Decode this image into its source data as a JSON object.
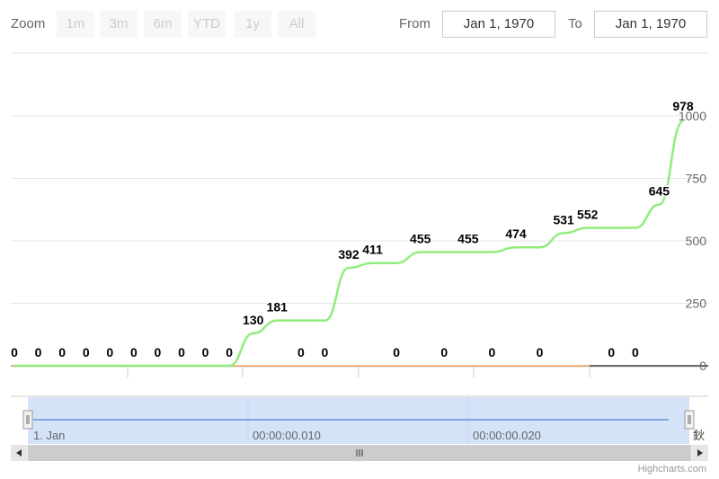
{
  "range_selector": {
    "zoom_label": "Zoom",
    "buttons": [
      "1m",
      "3m",
      "6m",
      "YTD",
      "1y",
      "All"
    ],
    "from_label": "From",
    "from_value": "Jan 1, 1970",
    "to_label": "To",
    "to_value": "Jan 1, 1970"
  },
  "navigator": {
    "labels": [
      "1. Jan",
      "00:00:00.010",
      "00:00:00.020"
    ],
    "right_glyph": "鈥"
  },
  "credit": "Highcharts.com",
  "colors": {
    "series": "#90ed7d",
    "navigator_fill": "#d4e3f7",
    "navigator_line": "#6a8fd8",
    "scrollbar": "#cccccc"
  },
  "chart_data": {
    "type": "line",
    "ylim": [
      0,
      1000
    ],
    "yticks": [
      0,
      250,
      500,
      750,
      1000
    ],
    "ytick_labels": [
      "0",
      "250",
      "500",
      "750",
      "1000"
    ],
    "grid": true,
    "series": [
      {
        "values": [
          0,
          0,
          0,
          0,
          0,
          0,
          0,
          0,
          0,
          0,
          130,
          181,
          181,
          181,
          392,
          411,
          411,
          455,
          455,
          455,
          455,
          474,
          474,
          531,
          552,
          552,
          552,
          645,
          978
        ],
        "label_values": [
          "0",
          "0",
          "0",
          "0",
          "0",
          "0",
          "0",
          "0",
          "0",
          "0",
          "130",
          "181",
          "0",
          "0",
          "392",
          "411",
          "0",
          "455",
          "0",
          "455",
          "0",
          "474",
          "0",
          "531",
          "552",
          "0",
          "0",
          "645",
          "978"
        ]
      }
    ]
  }
}
